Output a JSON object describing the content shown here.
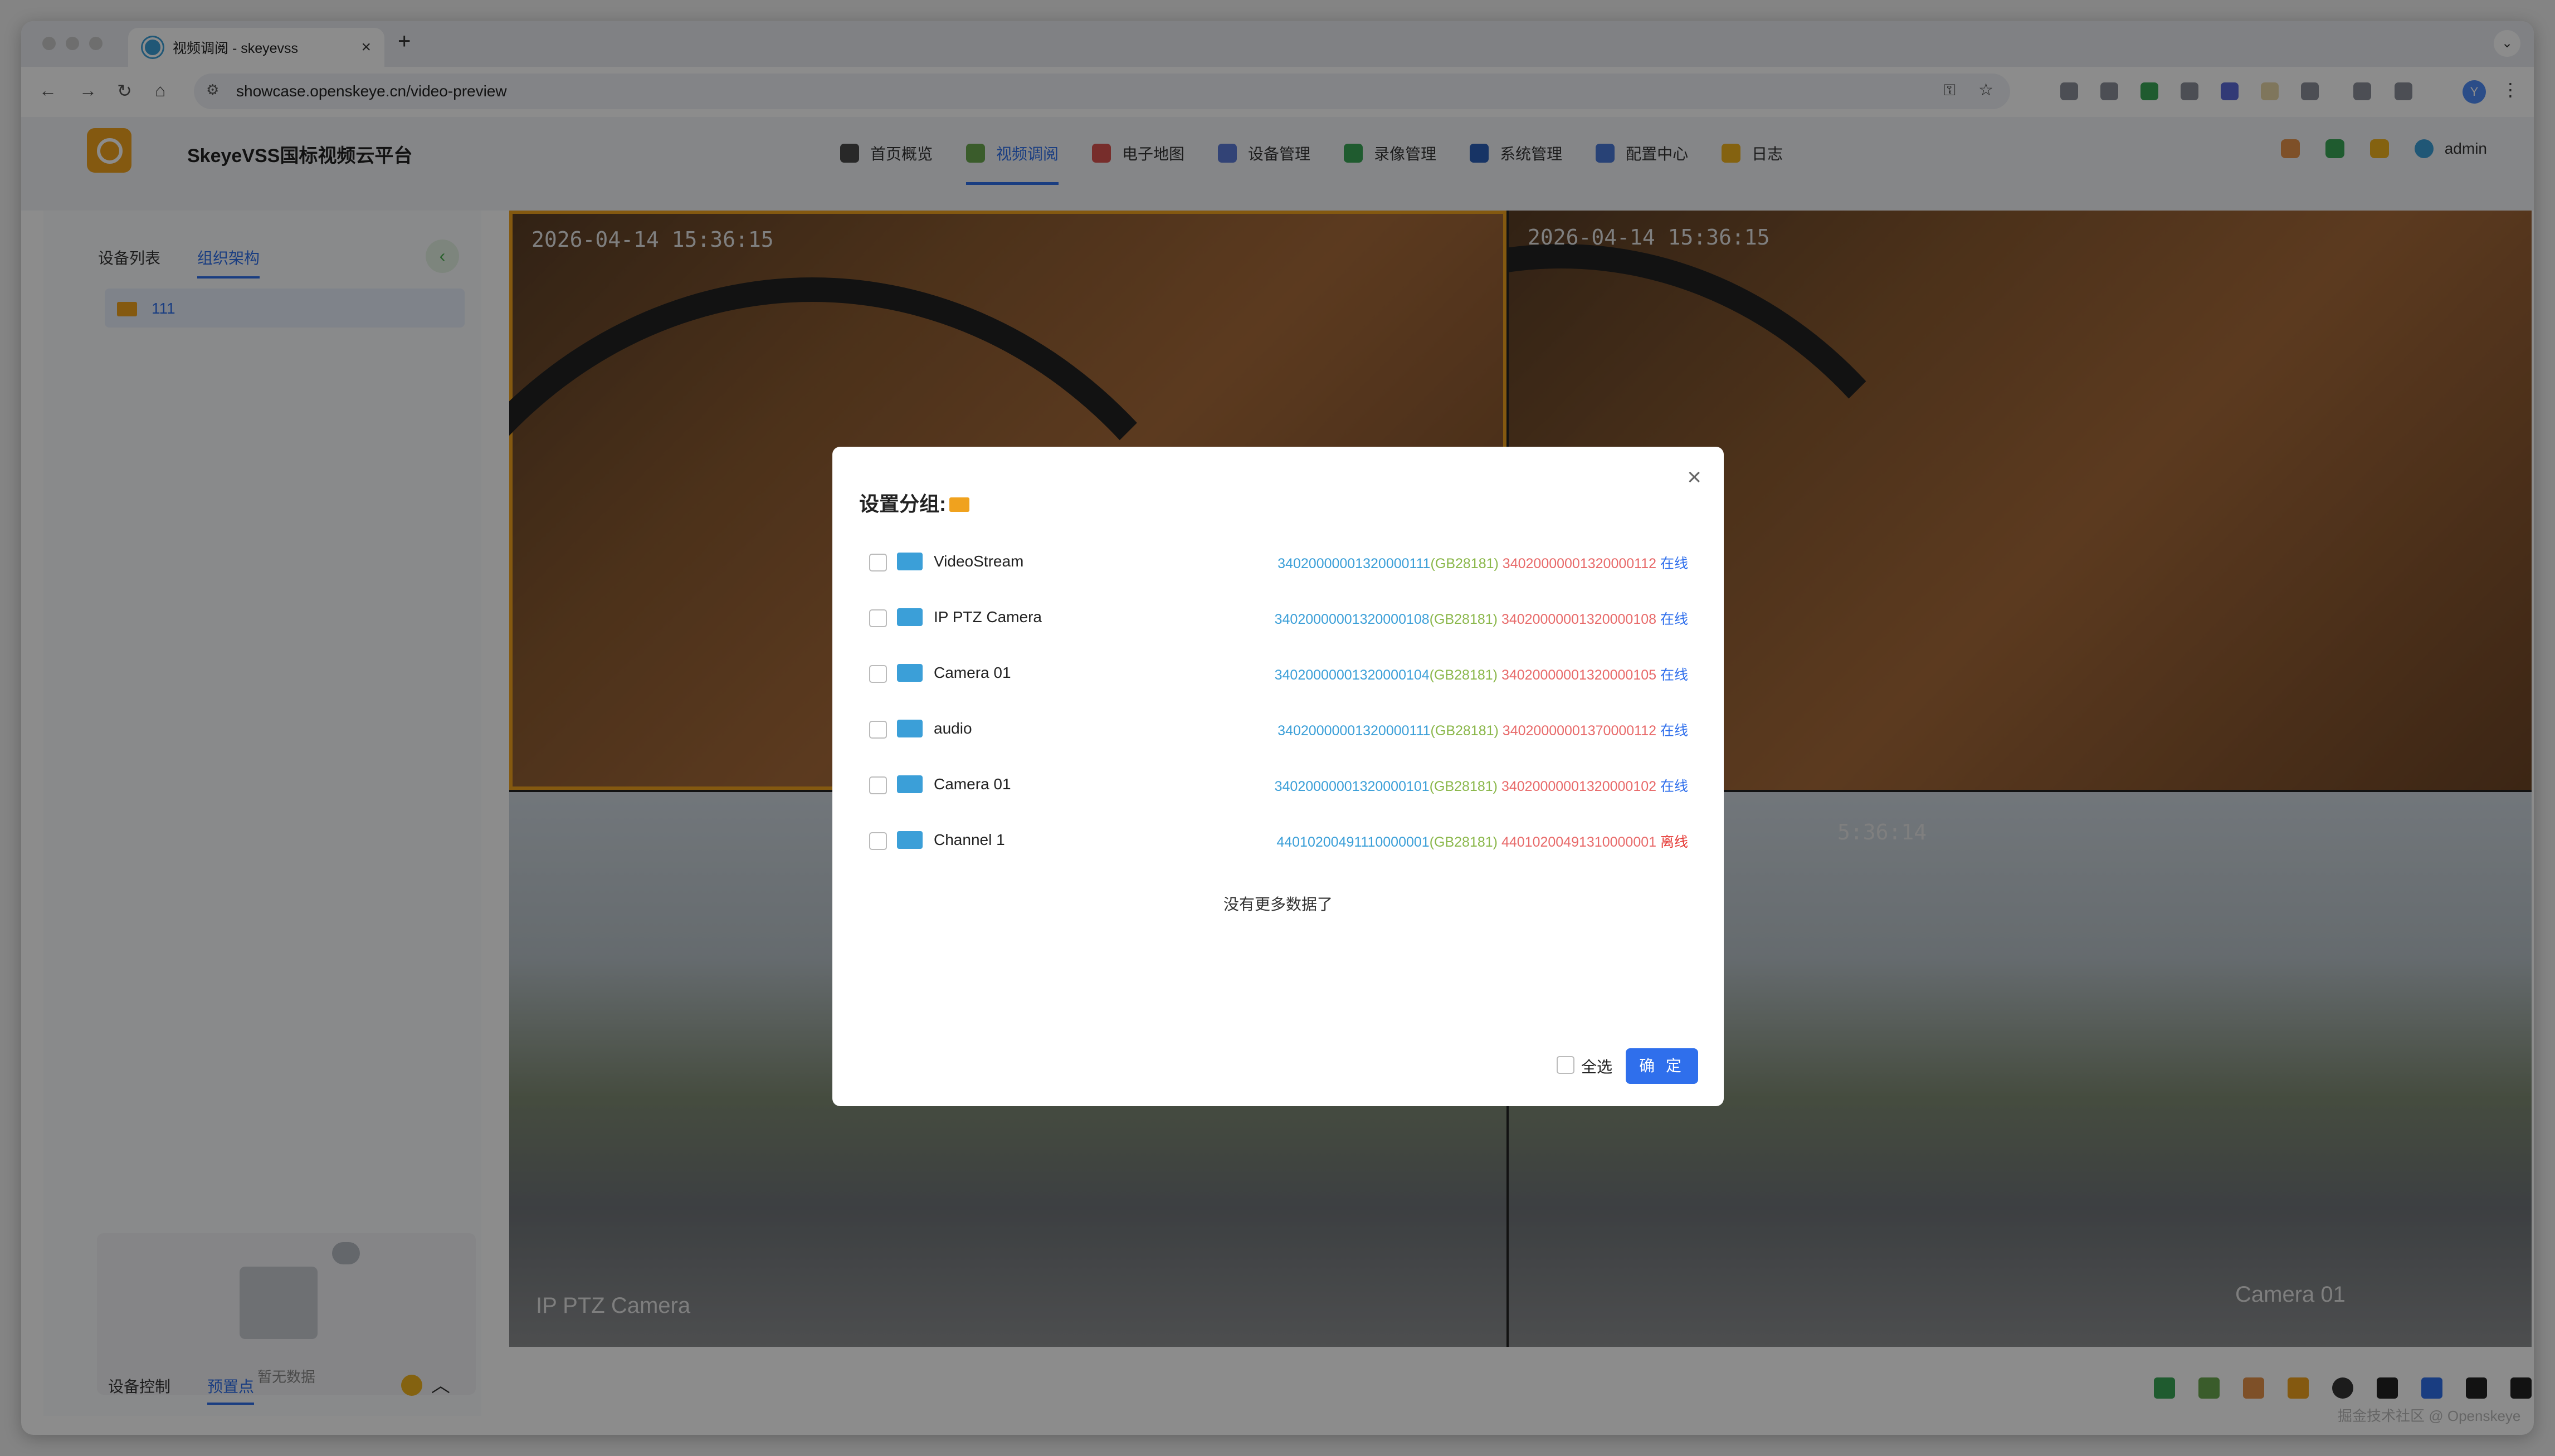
{
  "browser": {
    "tab_title": "视频调阅 - skeyevss",
    "new_tab": "+",
    "close": "×",
    "url": "showcase.openskeye.cn/video-preview",
    "profile_initial": "Y"
  },
  "app": {
    "brand": "SkeyeVSS国标视频云平台",
    "nav": [
      "首页概览",
      "视频调阅",
      "电子地图",
      "设备管理",
      "录像管理",
      "系统管理",
      "配置中心",
      "日志"
    ],
    "active_nav": "视频调阅",
    "user": "admin"
  },
  "sidebar": {
    "tabs": [
      "设备列表",
      "组织架构"
    ],
    "active_tab": "组织架构",
    "tree": [
      {
        "label": "111"
      }
    ],
    "empty_text": "暂无数据",
    "bottom_tabs": [
      "设备控制",
      "预置点"
    ],
    "active_bottom_tab": "预置点"
  },
  "video": {
    "timestamps": [
      "2026-04-14 15:36:15",
      "2026-04-14 15:36:15",
      "5:36:14"
    ],
    "channel_labels": [
      "IP PTZ Camera",
      "Camera 01"
    ]
  },
  "modal": {
    "title": "设置分组:",
    "rows": [
      {
        "name": "VideoStream",
        "device_id": "34020000001320000111",
        "protocol": "(GB28181)",
        "channel_id": "34020000001320000112",
        "status": "在线"
      },
      {
        "name": "IP PTZ Camera",
        "device_id": "34020000001320000108",
        "protocol": "(GB28181)",
        "channel_id": "34020000001320000108",
        "status": "在线"
      },
      {
        "name": "Camera 01",
        "device_id": "34020000001320000104",
        "protocol": "(GB28181)",
        "channel_id": "34020000001320000105",
        "status": "在线"
      },
      {
        "name": "audio",
        "device_id": "34020000001320000111",
        "protocol": "(GB28181)",
        "channel_id": "34020000001370000112",
        "status": "在线"
      },
      {
        "name": "Camera 01",
        "device_id": "34020000001320000101",
        "protocol": "(GB28181)",
        "channel_id": "34020000001320000102",
        "status": "在线"
      },
      {
        "name": "Channel 1",
        "device_id": "44010200491110000001",
        "protocol": "(GB28181)",
        "channel_id": "44010200491310000001",
        "status": "离线"
      }
    ],
    "no_more": "没有更多数据了",
    "select_all": "全选",
    "confirm": "确 定"
  },
  "footer": "掘金技术社区 @ Openskeye",
  "colors": {
    "accent": "#2f6fec",
    "brand": "#f0a21e",
    "online": "#2f6fec",
    "offline": "#e53935"
  }
}
